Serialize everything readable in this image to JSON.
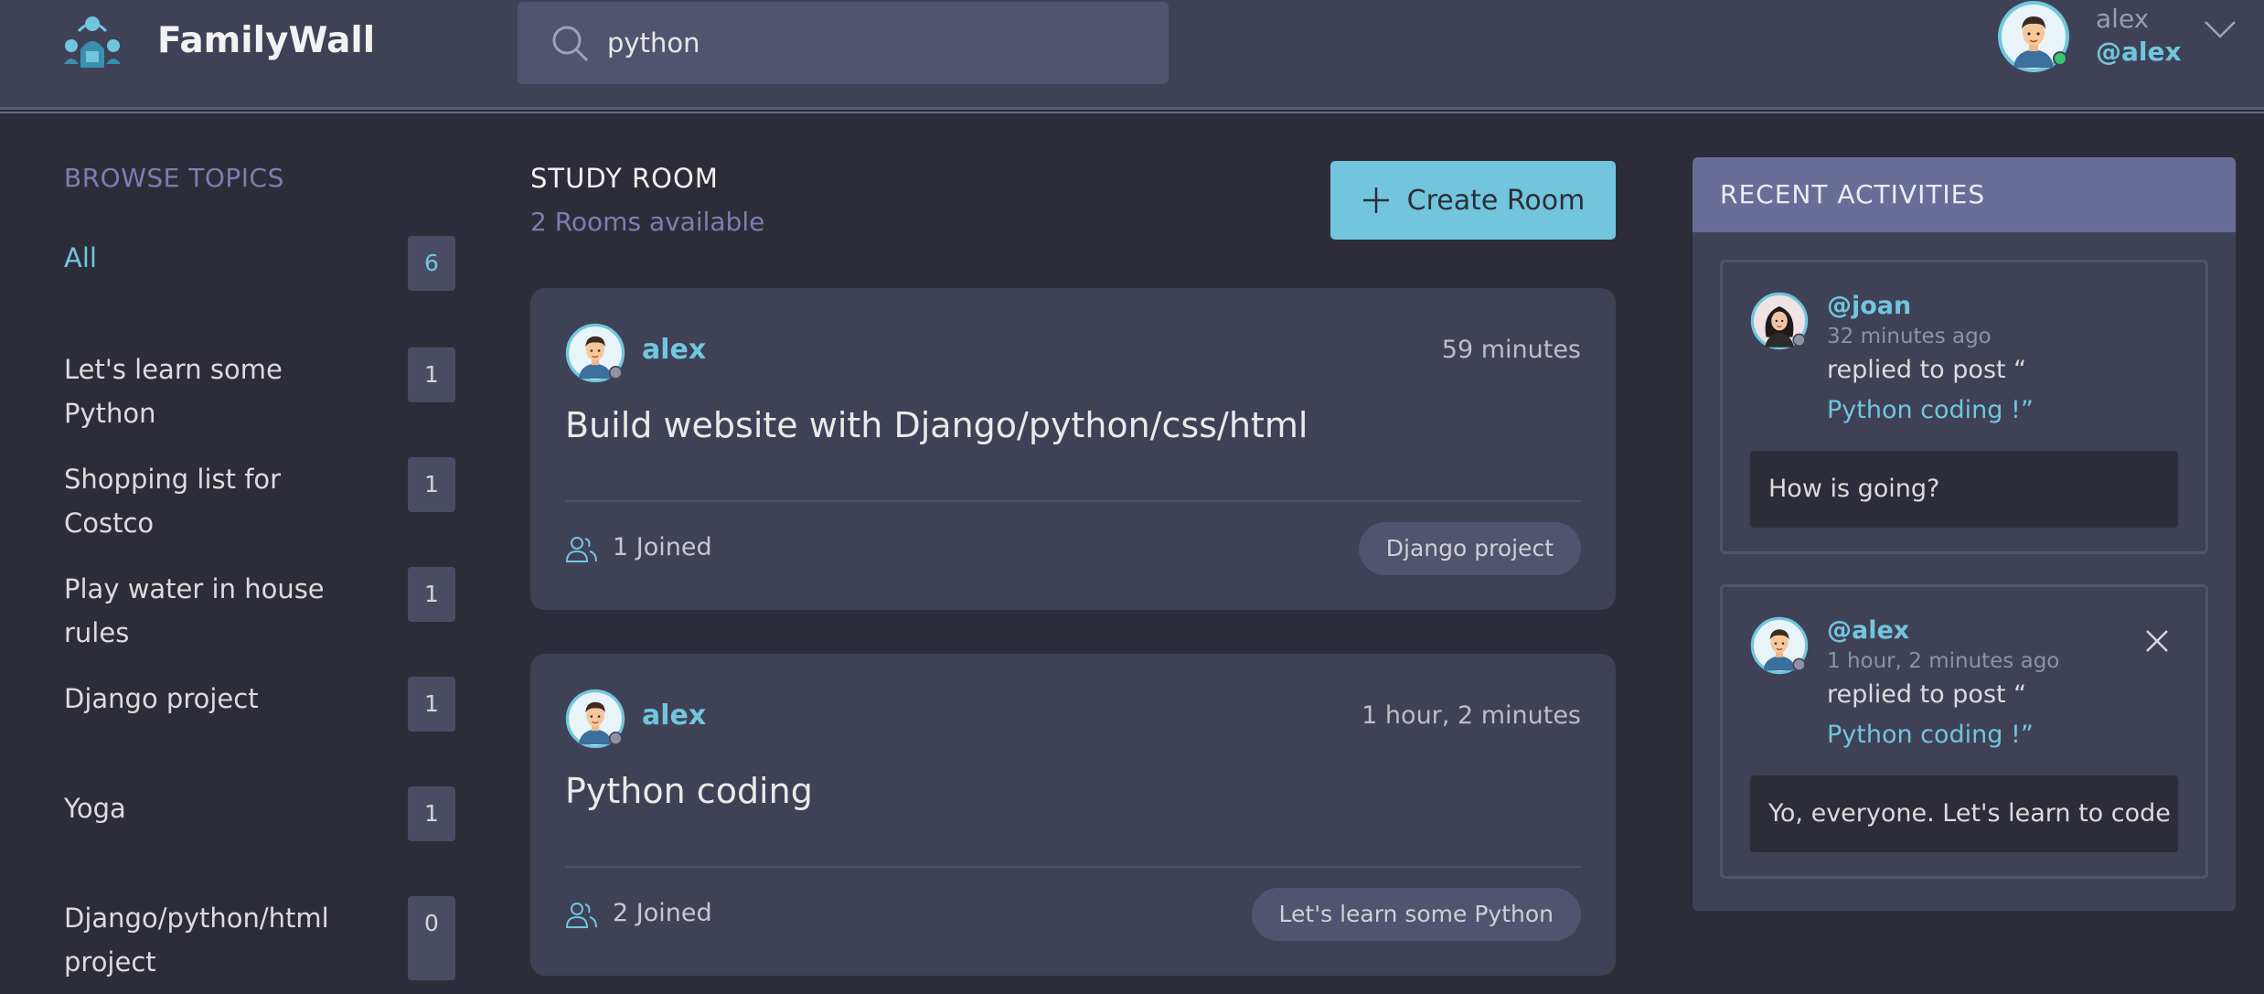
{
  "header": {
    "brand": "FamilyWall",
    "search_value": "python",
    "user_name": "alex",
    "user_handle": "@alex"
  },
  "sidebar": {
    "title": "BROWSE TOPICS",
    "topics": [
      {
        "label": "All",
        "count": "6"
      },
      {
        "label": "Let's learn some Python",
        "count": "1"
      },
      {
        "label": "Shopping list for Costco",
        "count": "1"
      },
      {
        "label": "Play water in house rules",
        "count": "1"
      },
      {
        "label": "Django project",
        "count": "1"
      },
      {
        "label": "Yoga",
        "count": "1"
      },
      {
        "label": "Django/python/html project",
        "count": "0"
      }
    ]
  },
  "main": {
    "heading": "STUDY ROOM",
    "subheading": "2 Rooms available",
    "create_label": "Create Room",
    "rooms": [
      {
        "host": "alex",
        "time": "59 minutes",
        "title": "Build website with Django/python/css/html",
        "joined": "1 Joined",
        "tag": "Django project"
      },
      {
        "host": "alex",
        "time": "1 hour, 2 minutes",
        "title": "Python coding",
        "joined": "2 Joined",
        "tag": "Let's learn some Python"
      }
    ]
  },
  "activities": {
    "title": "RECENT ACTIVITIES",
    "items": [
      {
        "handle": "@joan",
        "ago": "32 minutes ago",
        "text": "replied to post “",
        "link": "Python coding !”",
        "message": "How is going?"
      },
      {
        "handle": "@alex",
        "ago": "1 hour, 2 minutes ago",
        "text": "replied to post “",
        "link": "Python coding !”",
        "message": "Yo, everyone. Let's learn to code"
      }
    ]
  },
  "colors": {
    "background": "#2d2d39",
    "panel": "#3f4156",
    "accent": "#71c6dd",
    "header_band": "#696d97"
  }
}
